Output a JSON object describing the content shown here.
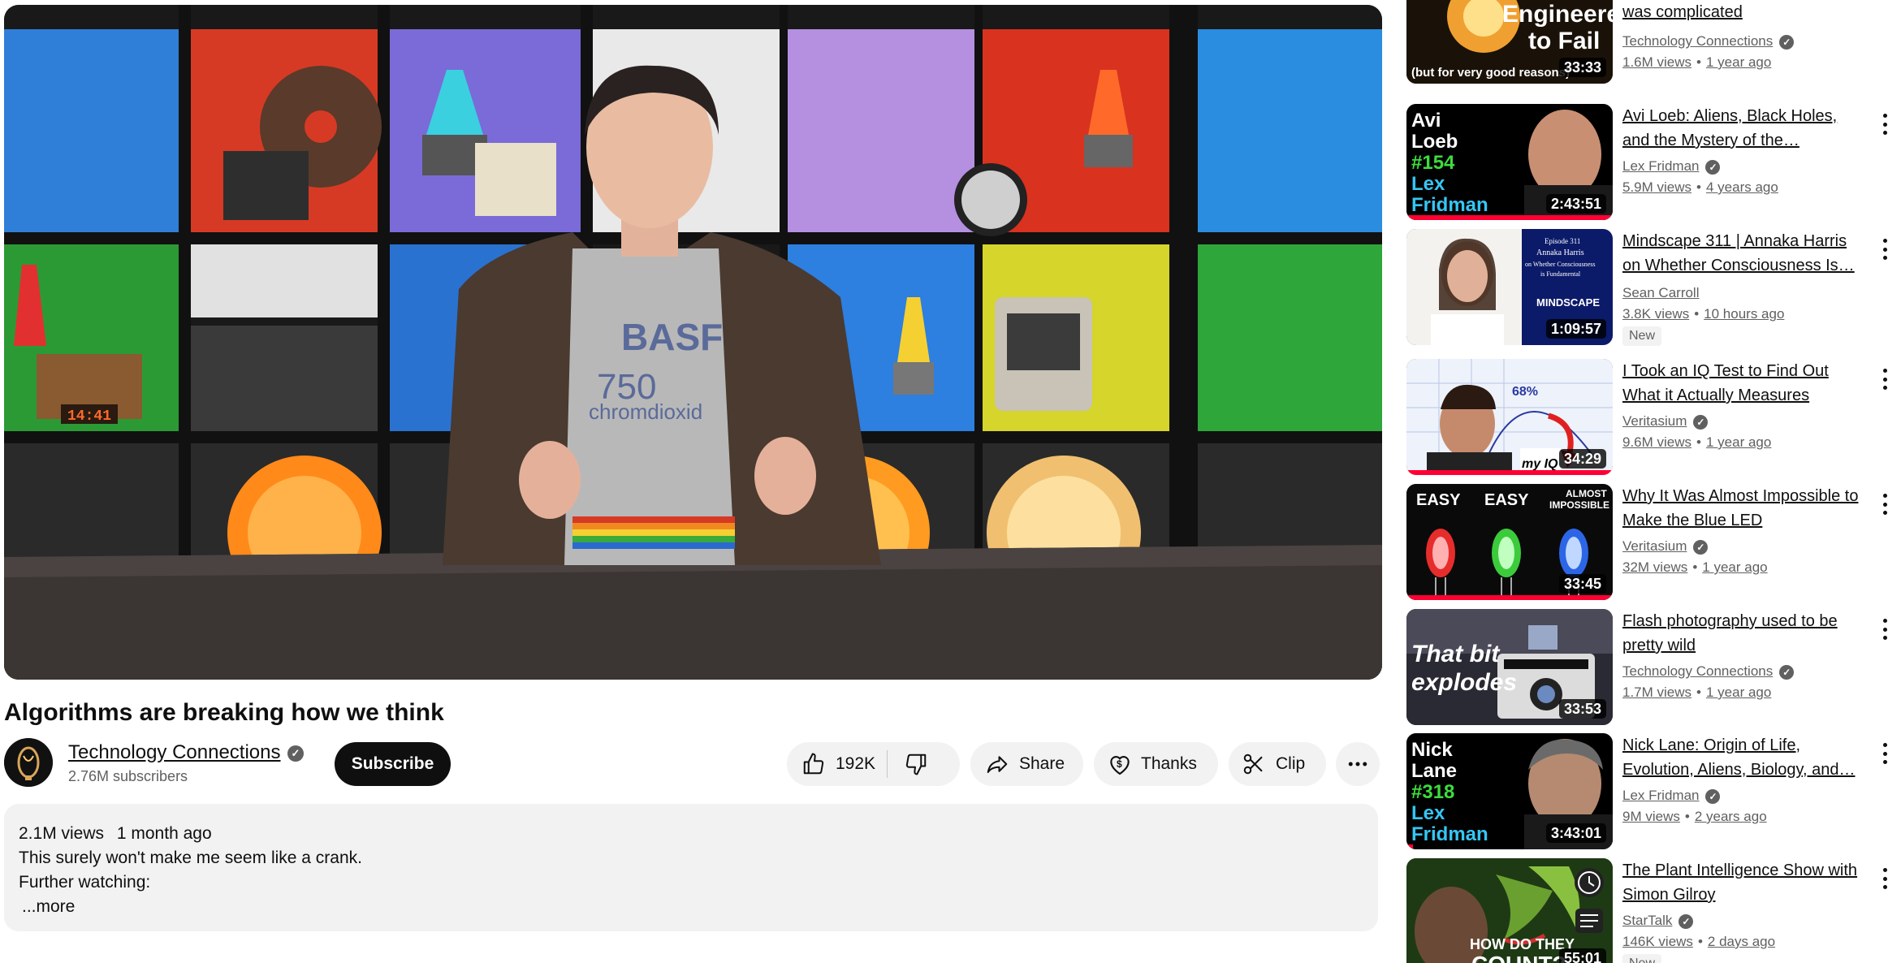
{
  "video": {
    "title": "Algorithms are breaking how we think",
    "player_shirt_text": "BASF",
    "player_shirt_number": "750",
    "player_shirt_sub": "chromdioxid",
    "player_clock_text": "14:41"
  },
  "owner": {
    "channel_name": "Technology Connections",
    "subscribers": "2.76M subscribers",
    "subscribe_label": "Subscribe"
  },
  "actions": {
    "like_count": "192K",
    "share_label": "Share",
    "thanks_label": "Thanks",
    "clip_label": "Clip"
  },
  "description": {
    "views": "2.1M views",
    "age": "1 month ago",
    "line1": "This surely won't make me seem like a crank.",
    "line2": "Further watching:",
    "more_label": "...more"
  },
  "recommendations": [
    {
      "title": "was complicated",
      "channel": "Technology Connections",
      "views": "1.6M views",
      "age": "1 year ago",
      "duration": "33:33",
      "thumb_text1": "Engineered",
      "thumb_text2": "to Fail",
      "thumb_text3": "(but for very good reasons)",
      "progress": 0,
      "has_menu": false
    },
    {
      "title": "Avi Loeb: Aliens, Black Holes, and the Mystery of the…",
      "channel": "Lex Fridman",
      "views": "5.9M views",
      "age": "4 years ago",
      "duration": "2:43:51",
      "thumb_text1": "Avi",
      "thumb_text2": "Loeb",
      "thumb_text3": "#154",
      "thumb_text4": "Lex",
      "thumb_text5": "Fridman",
      "progress": 1.0,
      "has_menu": true
    },
    {
      "title": "Mindscape 311 | Annaka Harris on Whether Consciousness Is…",
      "channel": "Sean Carroll",
      "views": "3.8K views",
      "age": "10 hours ago",
      "badge": "New",
      "duration": "1:09:57",
      "thumb_text1": "Episode 311",
      "thumb_text2": "Annaka Harris",
      "thumb_text3": "on Whether Consciousness",
      "thumb_text4": "is Fundamental",
      "thumb_text5": "MINDSCAPE",
      "progress": 0,
      "has_menu": true
    },
    {
      "title": "I Took an IQ Test to Find Out What it Actually Measures",
      "channel": "Veritasium",
      "views": "9.6M views",
      "age": "1 year ago",
      "duration": "34:29",
      "thumb_text1": "68%",
      "thumb_text2": "my IQ",
      "progress": 1.0,
      "has_menu": true
    },
    {
      "title": "Why It Was Almost Impossible to Make the Blue LED",
      "channel": "Veritasium",
      "views": "32M views",
      "age": "1 year ago",
      "duration": "33:45",
      "thumb_text1": "EASY",
      "thumb_text2": "EASY",
      "thumb_text3": "ALMOST",
      "thumb_text4": "IMPOSSIBLE",
      "progress": 1.0,
      "has_menu": true
    },
    {
      "title": "Flash photography used to be pretty wild",
      "channel": "Technology Connections",
      "views": "1.7M views",
      "age": "1 year ago",
      "duration": "33:53",
      "thumb_text1": "That bit",
      "thumb_text2": "explodes",
      "progress": 0,
      "has_menu": true
    },
    {
      "title": "Nick Lane: Origin of Life, Evolution, Aliens, Biology, and…",
      "channel": "Lex Fridman",
      "views": "9M views",
      "age": "2 years ago",
      "duration": "3:43:01",
      "thumb_text1": "Nick",
      "thumb_text2": "Lane",
      "thumb_text3": "#318",
      "thumb_text4": "Lex",
      "thumb_text5": "Fridman",
      "progress": 0.03,
      "has_menu": true
    },
    {
      "title": "The Plant Intelligence Show with Simon Gilroy",
      "channel": "StarTalk",
      "views": "146K views",
      "age": "2 days ago",
      "badge": "New",
      "duration": "55:01",
      "thumb_text1": "HOW DO THEY",
      "thumb_text2": "COUNT?",
      "progress": 0,
      "has_menu": true
    }
  ],
  "colors": {
    "accent_red": "#ff0033",
    "lex_green": "#3ddc3d",
    "lex_cyan": "#35c6f4"
  }
}
